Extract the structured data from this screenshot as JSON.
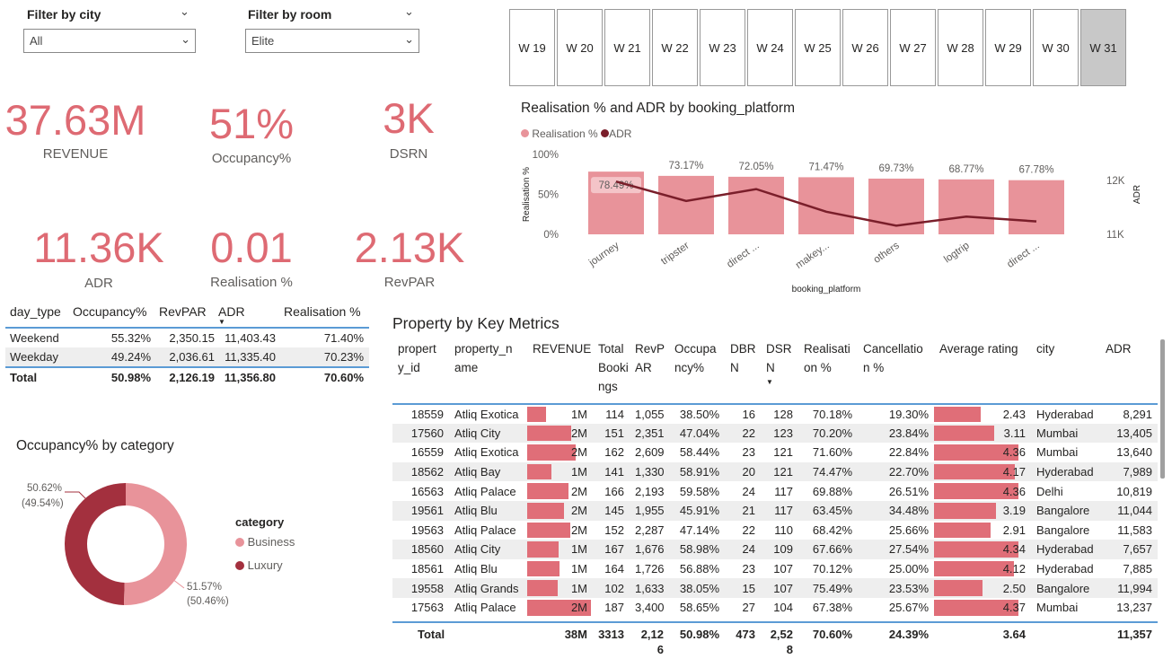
{
  "filters": {
    "city": {
      "label": "Filter by city",
      "value": "All"
    },
    "room": {
      "label": "Filter by room",
      "value": "Elite"
    }
  },
  "weeks": [
    "W 19",
    "W 20",
    "W 21",
    "W 22",
    "W 23",
    "W 24",
    "W 25",
    "W 26",
    "W 27",
    "W 28",
    "W 29",
    "W 30",
    "W 31"
  ],
  "selected_week": "W 31",
  "kpis": [
    {
      "value": "37.63M",
      "label": "REVENUE"
    },
    {
      "value": "51%",
      "label": "Occupancy%"
    },
    {
      "value": "3K",
      "label": "DSRN"
    },
    {
      "value": "11.36K",
      "label": "ADR"
    },
    {
      "value": "0.01",
      "label": "Realisation %"
    },
    {
      "value": "2.13K",
      "label": "RevPAR"
    }
  ],
  "day_type_table": {
    "headers": [
      "day_type",
      "Occupancy%",
      "RevPAR",
      "ADR",
      "Realisation %"
    ],
    "rows": [
      [
        "Weekend",
        "55.32%",
        "2,350.15",
        "11,403.43",
        "71.40%"
      ],
      [
        "Weekday",
        "49.24%",
        "2,036.61",
        "11,335.40",
        "70.23%"
      ]
    ],
    "total": [
      "Total",
      "50.98%",
      "2,126.19",
      "11,356.80",
      "70.60%"
    ]
  },
  "donut": {
    "title": "Occupancy% by category",
    "legend_title": "category",
    "items": [
      {
        "name": "Business",
        "pct": 51.57,
        "label": "51.57%",
        "sub": "(50.46%)",
        "color": "#e8939a"
      },
      {
        "name": "Luxury",
        "pct": 50.62,
        "label": "50.62%",
        "sub": "(49.54%)",
        "color": "#a3303e"
      }
    ]
  },
  "chart_data": {
    "type": "bar",
    "title": "Realisation % and ADR by booking_platform",
    "categories": [
      "journey",
      "tripster",
      "direct ...",
      "makey...",
      "others",
      "logtrip",
      "direct ..."
    ],
    "series": [
      {
        "name": "Realisation %",
        "values": [
          78.49,
          73.17,
          72.05,
          71.47,
          69.73,
          68.77,
          67.78
        ],
        "labels": [
          "78.49%",
          "73.17%",
          "72.05%",
          "71.47%",
          "69.73%",
          "68.77%",
          "67.78%"
        ],
        "color": "#e8939a"
      },
      {
        "name": "ADR",
        "values": [
          11980,
          11620,
          11840,
          11420,
          11160,
          11330,
          11240
        ],
        "color": "#7a1e2a"
      }
    ],
    "xlabel": "booking_platform",
    "ylabel": "Realisation %",
    "y2label": "ADR",
    "yticks": [
      "100%",
      "50%",
      "0%"
    ],
    "y2ticks": [
      "12K",
      "11K"
    ],
    "ylim": [
      0,
      100
    ],
    "y2lim": [
      11000,
      12000
    ],
    "legend": "top-left"
  },
  "property_table": {
    "title": "Property by Key Metrics",
    "headers": [
      "propert\ny_id",
      "property_n\name",
      "REVENUE",
      "Total\nBooki\nngs",
      "RevP\nAR",
      "Occupa\nncy%",
      "DBR\nN",
      "DSR\nN",
      "Realisati\non %",
      "Cancellatio\nn %",
      "Average rating",
      "city",
      "ADR"
    ],
    "rows": [
      {
        "id": "18559",
        "name": "Atliq Exotica",
        "rev": "1M",
        "revv": 1.0,
        "tb": "114",
        "revpar": "1,055",
        "occ": "38.50%",
        "dbrn": "16",
        "dsrn": "128",
        "real": "70.18%",
        "canc": "19.30%",
        "rating": "2.43",
        "ratingv": 2.43,
        "city": "Hyderabad",
        "adr": "8,291"
      },
      {
        "id": "17560",
        "name": "Atliq City",
        "rev": "2M",
        "revv": 2.35,
        "tb": "151",
        "revpar": "2,351",
        "occ": "47.04%",
        "dbrn": "22",
        "dsrn": "123",
        "real": "70.20%",
        "canc": "23.84%",
        "rating": "3.11",
        "ratingv": 3.11,
        "city": "Mumbai",
        "adr": "13,405"
      },
      {
        "id": "16559",
        "name": "Atliq Exotica",
        "rev": "2M",
        "revv": 2.6,
        "tb": "162",
        "revpar": "2,609",
        "occ": "58.44%",
        "dbrn": "23",
        "dsrn": "121",
        "real": "71.60%",
        "canc": "22.84%",
        "rating": "4.36",
        "ratingv": 4.36,
        "city": "Mumbai",
        "adr": "13,640"
      },
      {
        "id": "18562",
        "name": "Atliq Bay",
        "rev": "1M",
        "revv": 1.3,
        "tb": "141",
        "revpar": "1,330",
        "occ": "58.91%",
        "dbrn": "20",
        "dsrn": "121",
        "real": "74.47%",
        "canc": "22.70%",
        "rating": "4.17",
        "ratingv": 4.17,
        "city": "Hyderabad",
        "adr": "7,989"
      },
      {
        "id": "16563",
        "name": "Atliq Palace",
        "rev": "2M",
        "revv": 2.2,
        "tb": "166",
        "revpar": "2,193",
        "occ": "59.58%",
        "dbrn": "24",
        "dsrn": "117",
        "real": "69.88%",
        "canc": "26.51%",
        "rating": "4.36",
        "ratingv": 4.36,
        "city": "Delhi",
        "adr": "10,819"
      },
      {
        "id": "19561",
        "name": "Atliq Blu",
        "rev": "2M",
        "revv": 1.95,
        "tb": "145",
        "revpar": "1,955",
        "occ": "45.91%",
        "dbrn": "21",
        "dsrn": "117",
        "real": "63.45%",
        "canc": "34.48%",
        "rating": "3.19",
        "ratingv": 3.19,
        "city": "Bangalore",
        "adr": "11,044"
      },
      {
        "id": "19563",
        "name": "Atliq Palace",
        "rev": "2M",
        "revv": 2.29,
        "tb": "152",
        "revpar": "2,287",
        "occ": "47.14%",
        "dbrn": "22",
        "dsrn": "110",
        "real": "68.42%",
        "canc": "25.66%",
        "rating": "2.91",
        "ratingv": 2.91,
        "city": "Bangalore",
        "adr": "11,583"
      },
      {
        "id": "18560",
        "name": "Atliq City",
        "rev": "1M",
        "revv": 1.68,
        "tb": "167",
        "revpar": "1,676",
        "occ": "58.98%",
        "dbrn": "24",
        "dsrn": "109",
        "real": "67.66%",
        "canc": "27.54%",
        "rating": "4.34",
        "ratingv": 4.34,
        "city": "Hyderabad",
        "adr": "7,657"
      },
      {
        "id": "18561",
        "name": "Atliq Blu",
        "rev": "1M",
        "revv": 1.73,
        "tb": "164",
        "revpar": "1,726",
        "occ": "56.88%",
        "dbrn": "23",
        "dsrn": "107",
        "real": "70.12%",
        "canc": "25.00%",
        "rating": "4.12",
        "ratingv": 4.12,
        "city": "Hyderabad",
        "adr": "7,885"
      },
      {
        "id": "19558",
        "name": "Atliq Grands",
        "rev": "1M",
        "revv": 1.63,
        "tb": "102",
        "revpar": "1,633",
        "occ": "38.05%",
        "dbrn": "15",
        "dsrn": "107",
        "real": "75.49%",
        "canc": "23.53%",
        "rating": "2.50",
        "ratingv": 2.5,
        "city": "Bangalore",
        "adr": "11,994"
      },
      {
        "id": "17563",
        "name": "Atliq Palace",
        "rev": "2M",
        "revv": 3.4,
        "tb": "187",
        "revpar": "3,400",
        "occ": "58.65%",
        "dbrn": "27",
        "dsrn": "104",
        "real": "67.38%",
        "canc": "25.67%",
        "rating": "4.37",
        "ratingv": 4.37,
        "city": "Mumbai",
        "adr": "13,237"
      }
    ],
    "total": {
      "label": "Total",
      "rev": "38M",
      "tb": "3313",
      "revpar": "2,12\n6",
      "occ": "50.98%",
      "dbrn": "473",
      "dsrn": "2,52\n8",
      "real": "70.60%",
      "canc": "24.39%",
      "rating": "3.64",
      "adr": "11,357"
    }
  }
}
